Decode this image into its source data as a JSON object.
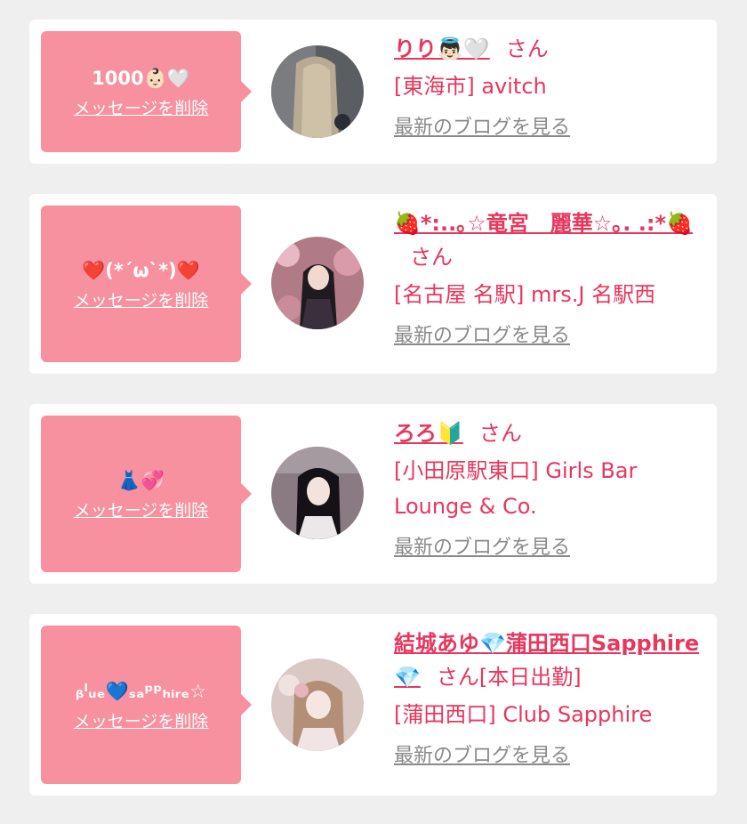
{
  "colors": {
    "accent": "#e8365d",
    "bubble": "#f7909f",
    "background": "#efefef"
  },
  "items": [
    {
      "message": "1000👶🏻🤍",
      "delete_label": "メッセージを削除",
      "name": "りり👼🏻🤍",
      "honorific": "さん",
      "extra": "",
      "shop": "[東海市] avitch",
      "blog_link": "最新のブログを見る"
    },
    {
      "message": "❤️(*´ω`*)❤️",
      "delete_label": "メッセージを削除",
      "name": "🍓*:..｡☆竜宮　麗華☆｡. .:*🍓",
      "honorific": "さん",
      "extra": "",
      "shop": "[名古屋 名駅] mrs.J 名駅西",
      "blog_link": "最新のブログを見る"
    },
    {
      "message": "👗💞",
      "delete_label": "メッセージを削除",
      "name": "ろろ🔰",
      "honorific": "さん",
      "extra": "",
      "shop": "[小田原駅東口] Girls Bar Lounge & Co.",
      "blog_link": "最新のブログを見る"
    },
    {
      "message": "ᵦˡᵤₑ💙ₛₐᵖᵖₕᵢᵣₑ☆",
      "delete_label": "メッセージを削除",
      "name": "結城あゆ💎蒲田西口Sapphire💎",
      "honorific": "さん",
      "extra": "[本日出勤]",
      "shop": "[蒲田西口] Club Sapphire",
      "blog_link": "最新のブログを見る"
    }
  ]
}
